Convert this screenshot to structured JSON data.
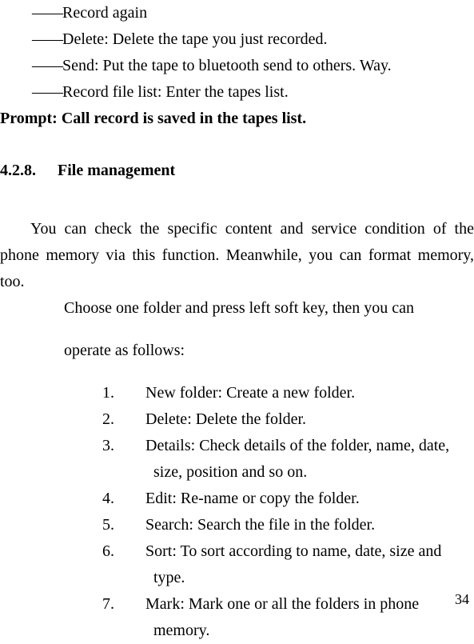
{
  "dash_block": {
    "dash": "——",
    "lines": [
      "Record again",
      "Delete: Delete the tape you just recorded.",
      "Send: Put the tape to bluetooth send to others. Way.",
      "Record file list: Enter the tapes list."
    ]
  },
  "prompt": "Prompt: Call record is saved in the tapes list.",
  "section": {
    "number": "4.2.8.",
    "title": "File management"
  },
  "intro": "You can check the specific content and service condition of the phone memory via this function. Meanwhile, you can format memory, too.",
  "choose_line1": "Choose one folder and press left soft key, then you can",
  "choose_line2": "operate as follows:",
  "ol": [
    "New folder: Create a new folder.",
    "Delete: Delete the folder.",
    "Details: Check details of the folder, name, date, size, position and so on.",
    "Edit: Re-name or copy the folder.",
    "Search: Search the file in the folder.",
    "Sort: To sort according to name, date, size and type.",
    "Mark: Mark one or all the folders in phone memory."
  ],
  "page_number": "34"
}
